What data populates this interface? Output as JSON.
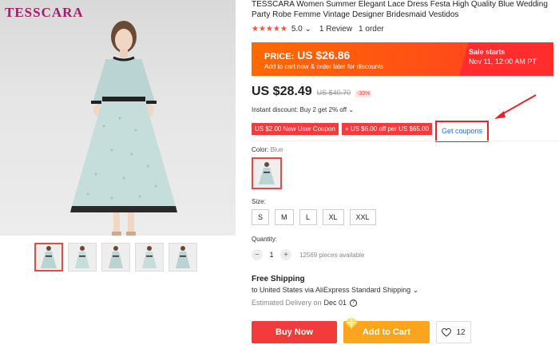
{
  "brand": {
    "logo_text": "TESSCARA"
  },
  "product": {
    "title": "TESSCARA Women Summer Elegant Lace Dress Festa High Quality Blue Wedding Party Robe Femme Vintage Designer Bridesmaid Vestidos",
    "rating": "5.0",
    "rating_caret": "⌄",
    "reviews": "1 Review",
    "orders": "1 order"
  },
  "promo": {
    "price_label": "PRICE:",
    "price_value": "US $26.86",
    "note": "Add to cart now & order later for discounts",
    "sale_line1": "Sale starts",
    "sale_line2": "Nov 11, 12:00 AM PT"
  },
  "price": {
    "current": "US $28.49",
    "original": "US $40.70",
    "discount": "-30%"
  },
  "instant_discount": "Instant discount: Buy 2 get 2% off ⌄",
  "coupons": {
    "new_user": "US $2.00 New User Coupon",
    "store": "+ US $6.00 off per US $65.00",
    "get_label": "Get coupons"
  },
  "color": {
    "label": "Color:",
    "value": "Blue"
  },
  "size": {
    "label": "Size:",
    "options": [
      "S",
      "M",
      "L",
      "XL",
      "XXL"
    ]
  },
  "quantity": {
    "label": "Quantity:",
    "value": "1",
    "minus": "−",
    "plus": "+",
    "available": "12569 pieces available"
  },
  "shipping": {
    "title": "Free Shipping",
    "to": "to United States via AliExpress Standard Shipping ⌄",
    "estimated_label": "Estimated Delivery on",
    "estimated_date": "Dec 01",
    "help": "?"
  },
  "actions": {
    "buy_now": "Buy Now",
    "add_to_cart": "Add to Cart",
    "wishlist_count": "12"
  },
  "colors": {
    "accent_red": "#f23b3b",
    "promo_orange": "#ff6a00",
    "cart_yellow": "#fba51f",
    "link_blue": "#2a6fd6"
  }
}
